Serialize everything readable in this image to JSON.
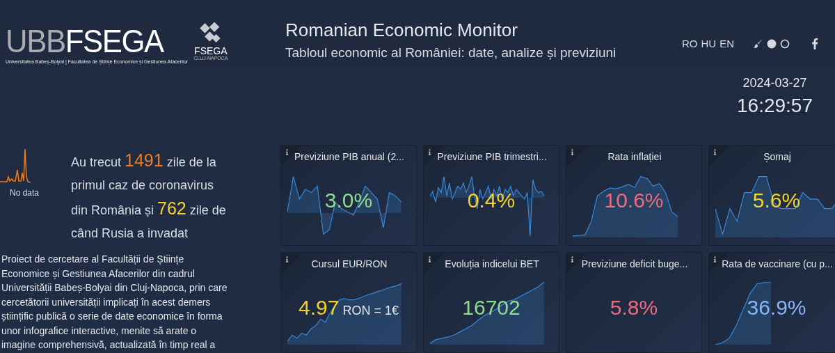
{
  "header": {
    "logo": {
      "part_1": "UBB",
      "part_2": "FSEGA",
      "caption": "Universitatea Babeș-Bolyai | Facultatea de Științe Economice și Gestiunea Afacerilor"
    },
    "emblem": {
      "name": "FSEGA",
      "city": "CLUJ-NAPOCA"
    },
    "title": "Romanian Economic Monitor",
    "subtitle": "Tabloul economic al României: date, analize și previziuni",
    "languages": [
      "RO",
      "HU",
      "EN"
    ],
    "date": "2024-03-27",
    "time": "16:29:57"
  },
  "covid": {
    "no_data": "No data",
    "counter": [
      {
        "text": "Au trecut "
      },
      {
        "text": "1491",
        "color": "#f07a1c"
      },
      {
        "text": " zile de la primul caz de coronavirus din România și "
      },
      {
        "text": "762",
        "color": "#f5d328"
      },
      {
        "text": " zile de când Rusia a invadat"
      }
    ]
  },
  "description": "Proiect de cercetare al Facultății de Științe Economice și Gestiunea Afacerilor din cadrul Universității Babeș-Bolyai din Cluj-Napoca, prin care cercetătorii universității implicați în acest demers științific publică o serie de date economice în forma unor infografice interactive, menite să arate o imagine comprehensivă, actualizată în timp real a",
  "cards": [
    {
      "title": "Previziune PIB anual (2...",
      "value": "3.0%",
      "color": "#8fdc8f"
    },
    {
      "title": "Previziune PIB trimestri...",
      "value": "0.4%",
      "color": "#f5d328"
    },
    {
      "title": "Rata inflației",
      "value": "10.6%",
      "color": "#f06a7e"
    },
    {
      "title": "Șomaj",
      "value": "5.6%",
      "color": "#f5d328"
    },
    {
      "title": "Cursul EUR/RON",
      "value": "4.97",
      "unit": "RON = 1€",
      "color": "#f5d328"
    },
    {
      "title": "Evoluția indicelui BET",
      "value": "16702",
      "color": "#8fdc8f"
    },
    {
      "title": "Previziune deficit buge...",
      "value": "5.8%",
      "color": "#f06a7e"
    },
    {
      "title": "Rata de vaccinare (cu p...",
      "value": "36.9%",
      "color": "#8ab4f8"
    }
  ]
}
